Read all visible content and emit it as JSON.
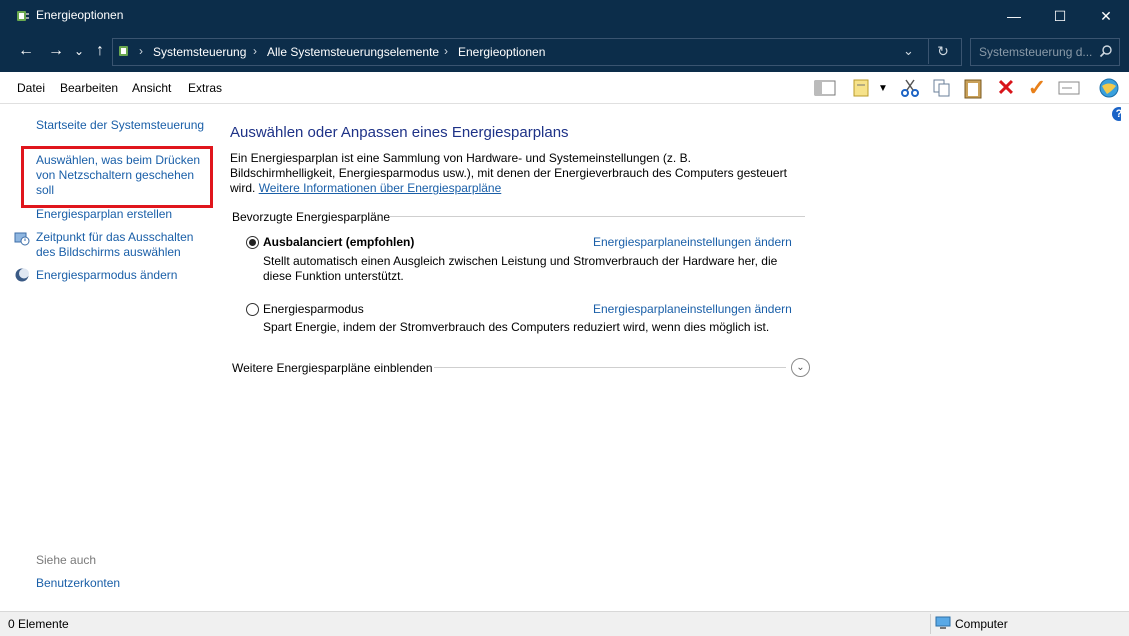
{
  "window": {
    "title": "Energieoptionen",
    "minimize": "—",
    "maximize": "☐",
    "close": "✕"
  },
  "nav": {
    "back": "←",
    "forward": "→",
    "recent": "⌄",
    "up": "↑"
  },
  "address": {
    "crumbs": [
      "Systemsteuerung",
      "Alle Systemsteuerungselemente",
      "Energieoptionen"
    ],
    "separator": "›",
    "dropdown": "⌄",
    "refresh": "↻"
  },
  "search": {
    "placeholder": "Systemsteuerung d..."
  },
  "menubar": {
    "items": [
      "Datei",
      "Bearbeiten",
      "Ansicht",
      "Extras"
    ]
  },
  "leftpane": {
    "home": "Startseite der Systemsteuerung",
    "power_buttons": "Auswählen, was beim Drücken von Netzschaltern geschehen soll",
    "create_plan": "Energiesparplan erstellen",
    "display_off": "Zeitpunkt für das Ausschalten des Bildschirms auswählen",
    "sleep_change": "Energiesparmodus ändern",
    "see_also": "Siehe auch",
    "user_accounts": "Benutzerkonten"
  },
  "main": {
    "title": "Auswählen oder Anpassen eines Energiesparplans",
    "desc_text": "Ein Energiesparplan ist eine Sammlung von Hardware- und Systemeinstellungen (z. B. Bildschirmhelligkeit, Energiesparmodus usw.), mit denen der Energieverbrauch des Computers gesteuert wird.",
    "desc_link": "Weitere Informationen über Energiesparpläne",
    "group_label": "Bevorzugte Energiesparpläne",
    "plans": [
      {
        "name": "Ausbalanciert (empfohlen)",
        "selected": true,
        "link": "Energiesparplaneinstellungen ändern",
        "description": "Stellt automatisch einen Ausgleich zwischen Leistung und Stromverbrauch der Hardware her, die diese Funktion unterstützt."
      },
      {
        "name": "Energiesparmodus",
        "selected": false,
        "link": "Energiesparplaneinstellungen ändern",
        "description": "Spart Energie, indem der Stromverbrauch des Computers reduziert wird, wenn dies möglich ist."
      }
    ],
    "more_plans": "Weitere Energiesparpläne einblenden",
    "expand_glyph": "⌄"
  },
  "statusbar": {
    "count": "0 Elemente",
    "location": "Computer"
  },
  "help_glyph": "?"
}
